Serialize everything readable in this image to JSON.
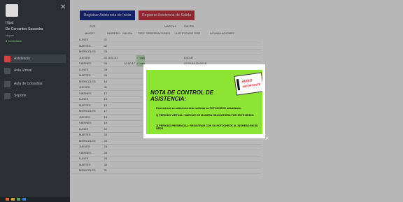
{
  "sidebar": {
    "role": "Hijod",
    "name": "De Cervantes Saavedra",
    "sub": "Miguel",
    "status": "● Conectado",
    "close_symbol": "✕",
    "items": [
      {
        "label": "Asistencia"
      },
      {
        "label": "Aula Virtual"
      },
      {
        "label": "Aula de Consultas"
      },
      {
        "label": "Soporte"
      }
    ]
  },
  "toolbar": {
    "btn_in_label": "Registrar Asistencia de Inicio",
    "btn_out_label": "Registrar Asistencia de Salida"
  },
  "table": {
    "header1": {
      "period": "2021",
      "marcas": "MARCAS",
      "salida": "SALIDA"
    },
    "header2": {
      "dia": "MARZO",
      "ingreso": "INGRESO",
      "salida": "SALIDA",
      "tipo": "TIPO",
      "observaciones": "OBSERVACIONES",
      "justificado": "JUSTIFICADO POR",
      "acumulaciones": "ACUMULACIONES"
    },
    "rows": [
      {
        "day": "LUNES",
        "num": "01",
        "in": "",
        "out": "",
        "tipo": "",
        "obs": ""
      },
      {
        "day": "MARTES",
        "num": "02",
        "in": "",
        "out": "",
        "tipo": "",
        "obs": ""
      },
      {
        "day": "MIÉRCOLES",
        "num": "03",
        "in": "",
        "out": "",
        "tipo": "",
        "obs": ""
      },
      {
        "day": "JUEVES",
        "num": "04",
        "in": "8:51:41",
        "out": "",
        "tipo": "✓ Validar",
        "obs": "8:00:47"
      },
      {
        "day": "VIERNES",
        "num": "05",
        "in": "",
        "out": "22:00:17",
        "tipo": "✓ Validar",
        "obs": "22:00:48 22:00:18"
      },
      {
        "day": "LUNES",
        "num": "08",
        "in": "",
        "out": "",
        "tipo": "",
        "obs": ""
      },
      {
        "day": "MARTES",
        "num": "09",
        "in": "",
        "out": "",
        "tipo": "",
        "obs": ""
      },
      {
        "day": "MIÉRCOLES",
        "num": "10",
        "in": "",
        "out": "",
        "tipo": "",
        "obs": ""
      },
      {
        "day": "JUEVES",
        "num": "11",
        "in": "",
        "out": "",
        "tipo": "",
        "obs": ""
      },
      {
        "day": "VIERNES",
        "num": "12",
        "in": "",
        "out": "",
        "tipo": "",
        "obs": ""
      },
      {
        "day": "LUNES",
        "num": "15",
        "in": "",
        "out": "",
        "tipo": "",
        "obs": ""
      },
      {
        "day": "MARTES",
        "num": "16",
        "in": "",
        "out": "",
        "tipo": "",
        "obs": ""
      },
      {
        "day": "MIÉRCOLES",
        "num": "17",
        "in": "",
        "out": "",
        "tipo": "",
        "obs": ""
      },
      {
        "day": "JUEVES",
        "num": "18",
        "in": "",
        "out": "",
        "tipo": "",
        "obs": ""
      },
      {
        "day": "VIERNES",
        "num": "19",
        "in": "",
        "out": "",
        "tipo": "",
        "obs": ""
      },
      {
        "day": "LUNES",
        "num": "22",
        "in": "",
        "out": "",
        "tipo": "",
        "obs": ""
      },
      {
        "day": "MARTES",
        "num": "23",
        "in": "",
        "out": "",
        "tipo": "",
        "obs": ""
      },
      {
        "day": "MIÉRCOLES",
        "num": "24",
        "in": "",
        "out": "",
        "tipo": "",
        "obs": ""
      },
      {
        "day": "JUEVES",
        "num": "25",
        "in": "",
        "out": "",
        "tipo": "",
        "obs": ""
      },
      {
        "day": "VIERNES",
        "num": "26",
        "in": "",
        "out": "",
        "tipo": "",
        "obs": ""
      },
      {
        "day": "LUNES",
        "num": "29",
        "in": "",
        "out": "",
        "tipo": "",
        "obs": ""
      },
      {
        "day": "MARTES",
        "num": "30",
        "in": "",
        "out": "",
        "tipo": "",
        "obs": ""
      },
      {
        "day": "MIÉRCOLES",
        "num": "31",
        "in": "",
        "out": "",
        "tipo": "",
        "obs": ""
      }
    ]
  },
  "modal": {
    "title": "NOTA DE CONTROL DE ASISTENCIA:",
    "badge_top": "AVISO",
    "badge_bottom": "IMPORTANTE",
    "line1": "Para marcar su asistencia debe solicitar su FOTOCHECK actualizado.",
    "line2": "1) PERIODO VIRTUAL:  MARCAR DE MANERA OBLIGATORIA POR ESTE MEDIO.",
    "line3": "2) PERIODO PRESENCIAL: REGISTRAR CON SU FOTOCHECK AL INGRESO EN SU SEDE.",
    "close_symbol": "✕"
  },
  "colors": {
    "btn_in": "#1d2e8f",
    "btn_out": "#c73544",
    "notice_bg": "#8ee432",
    "sidebar_bg": "#2b2e33"
  }
}
